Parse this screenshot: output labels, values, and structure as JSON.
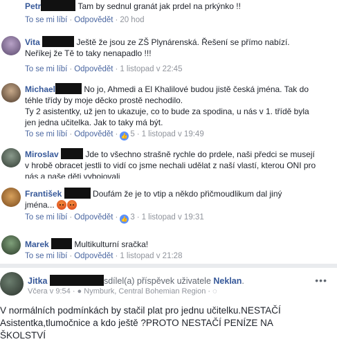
{
  "comments": [
    {
      "name": "Petr",
      "text": "Tam by sednul granát jak prdel na prkýnko !!",
      "like_label": "To se mi líbí",
      "reply_label": "Odpovědět",
      "time": "20 hod"
    },
    {
      "name": "Vita",
      "text_lines": [
        "Ještě že jsou ze ZŠ Plynárenská. Řešení se přímo nabízí.",
        "Neříkej že Tě to taky nenapadlo !!!"
      ],
      "like_label": "To se mi líbí",
      "reply_label": "Odpovědět",
      "time": "1 listopad v 22:45"
    },
    {
      "name": "Michael",
      "text_lines": [
        "No jo, Ahmedi a El Khalilové budou jistě česká jména. Tak do",
        "téhle třídy by moje děcko prostě nechodilo.",
        "Ty 2 asistentky, už jen to ukazuje, co to bude za spodina, u nás v 1. třídě byla",
        "jen jedna učitelka. Jak to taky má být."
      ],
      "like_label": "To se mi líbí",
      "reply_label": "Odpovědět",
      "like_count": "5",
      "time": "1 listopad v 19:49"
    },
    {
      "name": "Miroslav",
      "text_lines": [
        "Jde to všechno strašně rychle do prdele, naši předci se musejí",
        "v hrobě obracet jestli to vidí co jsme nechali udělat z naší vlastí, kterou ONI pro",
        "nás a naše děti vybojovali"
      ]
    },
    {
      "name": "František",
      "text_lines": [
        "Doufám že je to vtip a někdo přičmoudlikum dal jiný",
        "jména..."
      ],
      "like_label": "To se mi líbí",
      "reply_label": "Odpovědět",
      "like_count": "3",
      "time": "1 listopad v 19:31"
    },
    {
      "name": "Marek",
      "text": "Multikulturní sračka!",
      "like_label": "To se mi líbí",
      "reply_label": "Odpovědět",
      "time": "1 listopad v 21:28"
    }
  ],
  "post": {
    "author": "Jitka",
    "shared_text": "sdílel(a) příspěvek uživatele",
    "shared_from": "Neklan",
    "time": "Včera v 9:54",
    "location": "Nymburk, Central Bohemian Region",
    "more": "•••",
    "text_lines": [
      "V normálních podmínkách by stačil plat pro jednu učitelku.NESTAČÍ",
      "Asistentka,tlumočnice a kdo ještě ?PROTO NESTAČÍ PENÍZE NA",
      "ŠKOLSTVÍ"
    ]
  },
  "colors": {
    "link": "#365899",
    "meta": "#90949c",
    "like_badge": "#5890ff"
  }
}
